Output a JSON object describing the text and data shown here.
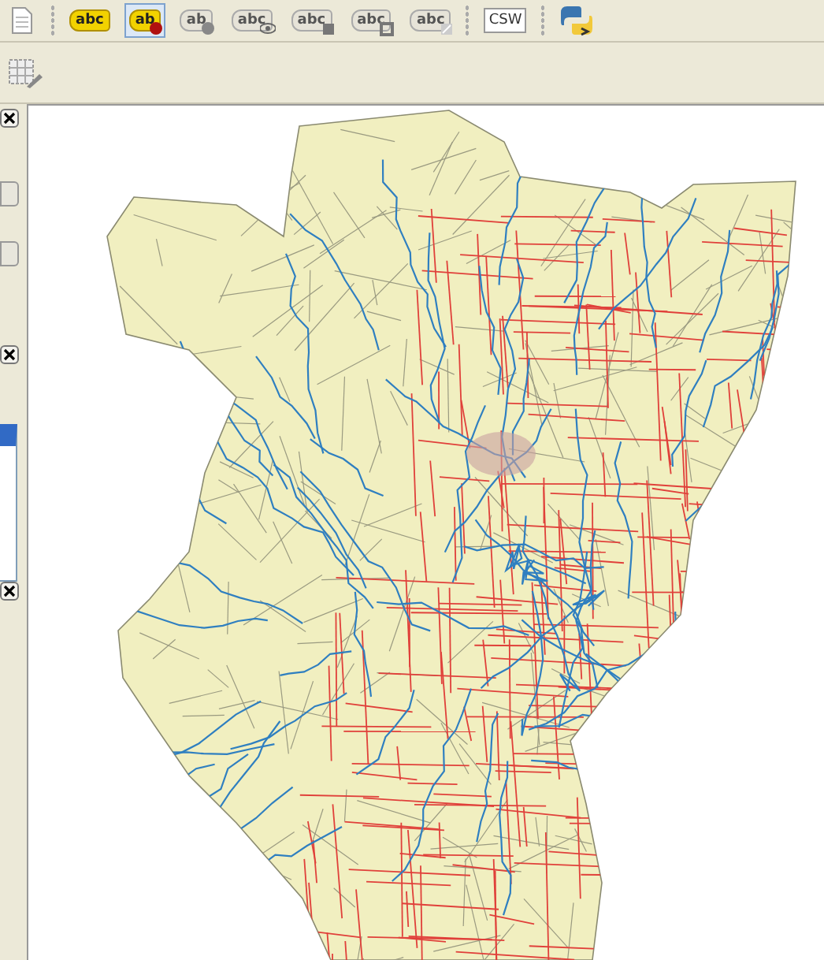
{
  "toolbar": {
    "items": [
      {
        "kind": "document"
      },
      {
        "kind": "handle"
      },
      {
        "kind": "yellow",
        "text": "abc",
        "selected": false
      },
      {
        "kind": "pinred",
        "text": "ab",
        "selected": true
      },
      {
        "kind": "pingrey",
        "text": "ab",
        "selected": false
      },
      {
        "kind": "eye",
        "text": "abc",
        "selected": false
      },
      {
        "kind": "move",
        "text": "abc",
        "selected": false
      },
      {
        "kind": "rotate",
        "text": "abc",
        "selected": false
      },
      {
        "kind": "edit",
        "text": "abc",
        "selected": false
      },
      {
        "kind": "handle"
      },
      {
        "kind": "csw",
        "text": "CSW"
      },
      {
        "kind": "handle"
      },
      {
        "kind": "python"
      }
    ]
  },
  "toolbar_2": {
    "items": [
      {
        "kind": "grid-edit"
      }
    ]
  },
  "dock": {
    "panels": [
      {
        "kind": "spinner"
      },
      {
        "kind": "list",
        "selected": true
      },
      {
        "kind": "plain"
      }
    ]
  }
}
